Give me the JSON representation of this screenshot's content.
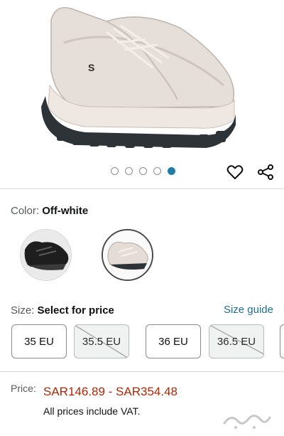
{
  "gallery": {
    "image_alt": "Skechers off-white chunky sneaker",
    "brand_mark": "S",
    "dot_count": 5,
    "active_dot": 5
  },
  "color": {
    "label": "Color: ",
    "selected": "Off-white",
    "swatches": [
      "Black",
      "Off-white"
    ]
  },
  "size": {
    "label": "Size: ",
    "selected": "Select for price",
    "guide_label": "Size guide",
    "options": [
      {
        "label": "35 EU",
        "available": true
      },
      {
        "label": "35.5 EU",
        "available": false
      },
      {
        "label": "36 EU",
        "available": true
      },
      {
        "label": "36.5 EU",
        "available": false
      }
    ]
  },
  "price": {
    "label": "Price:",
    "range": "SAR146.89 - SAR354.48",
    "vat_note": "All prices include VAT."
  },
  "colors": {
    "accent_blue": "#1f7ca7",
    "price_red": "#b12704",
    "link": "#1f6f8f"
  }
}
